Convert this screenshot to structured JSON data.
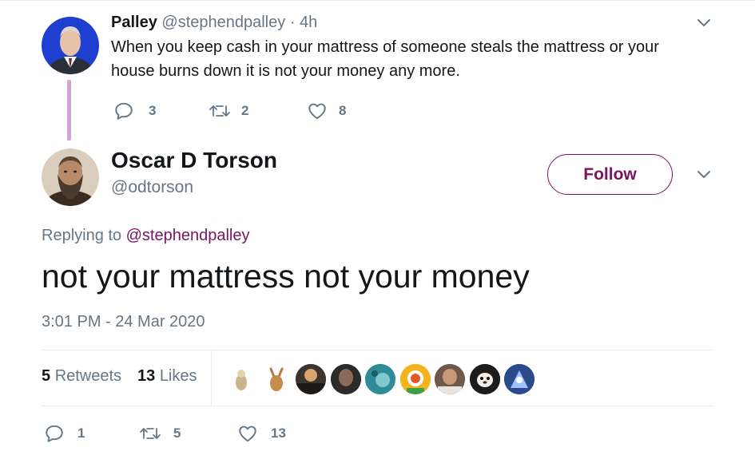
{
  "parent_tweet": {
    "name": "Palley",
    "handle": "@stephendpalley",
    "dot": "·",
    "time": "4h",
    "text": "When you keep cash in your mattress of someone steals the mattress or your house burns down it is not your money any more.",
    "reply_count": "3",
    "retweet_count": "2",
    "like_count": "8"
  },
  "main_tweet": {
    "name": "Oscar D Torson",
    "handle": "@odtorson",
    "follow_label": "Follow",
    "replying_prefix": "Replying to",
    "replying_to": "@stephendpalley",
    "text": "not your mattress not your money",
    "timestamp": "3:01 PM - 24 Mar 2020",
    "retweets_count": "5",
    "retweets_label": "Retweets",
    "likes_count": "13",
    "likes_label": "Likes",
    "reply_count": "1",
    "retweet_count": "5",
    "like_count": "13"
  },
  "colors": {
    "accent": "#79145f",
    "muted": "#657786",
    "text": "#14171a",
    "thread_line": "#cfa6cf"
  }
}
